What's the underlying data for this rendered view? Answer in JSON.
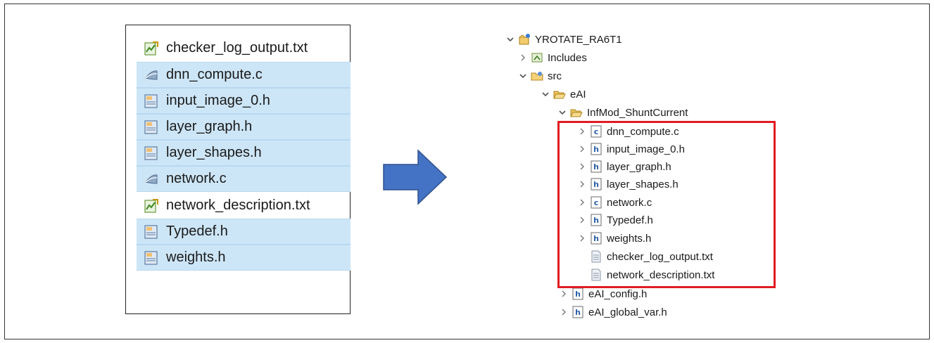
{
  "left_panel": {
    "files": [
      {
        "name": "checker_log_output.txt",
        "icon": "text-file-icon",
        "selected": false
      },
      {
        "name": "dnn_compute.c",
        "icon": "c-source-icon",
        "selected": true
      },
      {
        "name": "input_image_0.h",
        "icon": "header-file-icon",
        "selected": true
      },
      {
        "name": "layer_graph.h",
        "icon": "header-file-icon",
        "selected": true
      },
      {
        "name": "layer_shapes.h",
        "icon": "header-file-icon",
        "selected": true
      },
      {
        "name": "network.c",
        "icon": "c-source-icon",
        "selected": true
      },
      {
        "name": "network_description.txt",
        "icon": "text-file-icon",
        "selected": false
      },
      {
        "name": "Typedef.h",
        "icon": "header-file-icon",
        "selected": true
      },
      {
        "name": "weights.h",
        "icon": "header-file-icon",
        "selected": true
      }
    ]
  },
  "tree": {
    "project": "YROTATE_RA6T1",
    "includes": "Includes",
    "src": "src",
    "eai": "eAI",
    "infmod": "InfMod_ShuntCurrent",
    "children": [
      {
        "name": "dnn_compute.c",
        "type": "c"
      },
      {
        "name": "input_image_0.h",
        "type": "h"
      },
      {
        "name": "layer_graph.h",
        "type": "h"
      },
      {
        "name": "layer_shapes.h",
        "type": "h"
      },
      {
        "name": "network.c",
        "type": "c"
      },
      {
        "name": "Typedef.h",
        "type": "h"
      },
      {
        "name": "weights.h",
        "type": "h"
      },
      {
        "name": "checker_log_output.txt",
        "type": "txt"
      },
      {
        "name": "network_description.txt",
        "type": "txt"
      }
    ],
    "eai_config": "eAI_config.h",
    "eai_global": "eAI_global_var.h"
  },
  "colors": {
    "highlight": "#e21b22",
    "selection": "#cde6f7",
    "arrow": "#4472c4"
  }
}
